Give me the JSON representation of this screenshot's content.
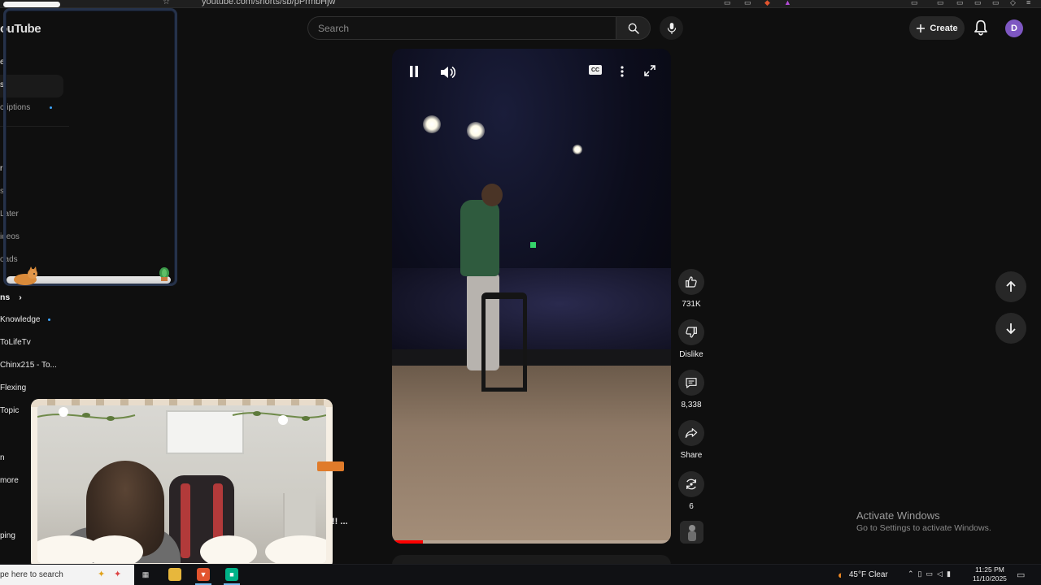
{
  "browser": {
    "url": "youtube.com/shorts/sb/pPrmbHjw"
  },
  "header": {
    "logo_text": "ouTube",
    "search_placeholder": "Search",
    "create_label": "Create",
    "avatar_letter": "D",
    "avatar_color": "#7e57c2"
  },
  "sidebar": {
    "items": [
      {
        "label": "e"
      },
      {
        "label": "s"
      },
      {
        "label": "criptions"
      },
      {
        "label": "r"
      },
      {
        "label": "s"
      },
      {
        "label": "Later"
      },
      {
        "label": "ideos"
      },
      {
        "label": "oads"
      }
    ],
    "subscriptions_header": "ns",
    "channels": [
      {
        "label": "Knowledge"
      },
      {
        "label": "ToLifeTv"
      },
      {
        "label": "Chinx215 - To..."
      },
      {
        "label": "Flexing"
      },
      {
        "label": "Topic"
      },
      {
        "label": "n"
      },
      {
        "label": "more"
      },
      {
        "label": "ping"
      }
    ]
  },
  "overlay": {
    "side_text": "!! ..."
  },
  "player": {
    "progress_fraction": 0.11,
    "controls": {
      "pause_icon": "pause-icon",
      "volume_icon": "volume-icon",
      "cc_label": "CC",
      "more_icon": "more-vertical-icon",
      "fullscreen_icon": "fullscreen-icon"
    }
  },
  "actions": {
    "like_count": "731K",
    "dislike_label": "Dislike",
    "comment_count": "8,338",
    "share_label": "Share",
    "remix_count": "6"
  },
  "watermark": {
    "title": "Activate Windows",
    "subtitle": "Go to Settings to activate Windows."
  },
  "taskbar": {
    "search_text": "pe here to search",
    "weather": "45°F  Clear",
    "time": "11:25 PM",
    "date": "11/10/2025"
  },
  "colors": {
    "background": "#0f0f0f",
    "accent_red": "#ff0000",
    "live_dot": "#3ea6ff"
  }
}
